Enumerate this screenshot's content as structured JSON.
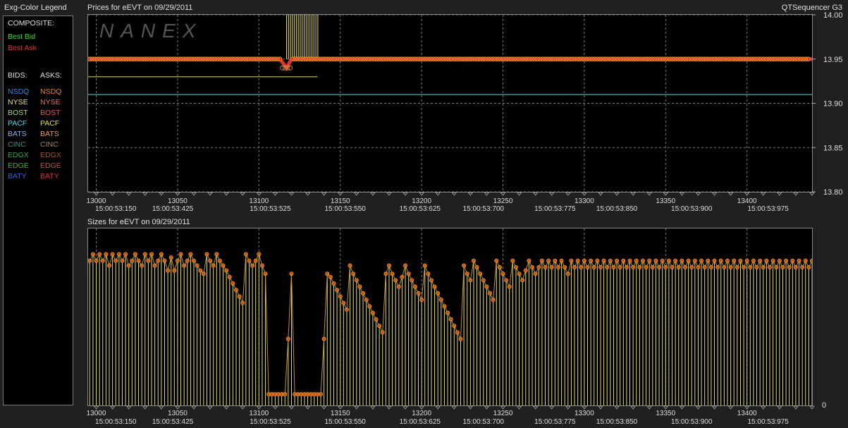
{
  "legend": {
    "title": "Exg-Color Legend",
    "composite_label": "COMPOSITE:",
    "best_bid": "Best Bid",
    "best_ask": "Best Ask",
    "bids_label": "BIDS:",
    "asks_label": "ASKS:",
    "exchanges": [
      {
        "bid": "NSDQ",
        "ask": "NSDQ",
        "bid_color": "#3a8ad8",
        "ask_color": "#e0803a"
      },
      {
        "bid": "NYSE",
        "ask": "NYSE",
        "bid_color": "#e8e060",
        "ask_color": "#e07070"
      },
      {
        "bid": "BOST",
        "ask": "BOST",
        "bid_color": "#b0d870",
        "ask_color": "#d06060"
      },
      {
        "bid": "PACF",
        "ask": "PACF",
        "bid_color": "#40e0e0",
        "ask_color": "#e0e040"
      },
      {
        "bid": "BATS",
        "ask": "BATS",
        "bid_color": "#8ab0f0",
        "ask_color": "#e0a060"
      },
      {
        "bid": "CINC",
        "ask": "CINC",
        "bid_color": "#3a9090",
        "ask_color": "#a08a50"
      },
      {
        "bid": "EDGX",
        "ask": "EDGX",
        "bid_color": "#30a050",
        "ask_color": "#a05030"
      },
      {
        "bid": "EDGE",
        "ask": "EDGE",
        "bid_color": "#40b040",
        "ask_color": "#c05040"
      },
      {
        "bid": "BATY",
        "ask": "BATY",
        "bid_color": "#3060d0",
        "ask_color": "#d03030"
      }
    ],
    "colors": {
      "best_bid": "#30e030",
      "best_ask": "#e03030"
    }
  },
  "header": {
    "prices_title": "Prices for  eEVT  on  09/29/2011",
    "sizes_title": "Sizes for  eEVT  on  09/29/2011",
    "app_name": "QTSequencer G3",
    "watermark": "NANEX"
  },
  "chart_data": [
    {
      "type": "line",
      "title": "Prices for  eEVT  on  09/29/2011",
      "xlim": [
        12995,
        13440
      ],
      "ylim": [
        13.8,
        14.0
      ],
      "yticks": [
        "14.00",
        "13.95",
        "13.90",
        "13.85",
        "13.80"
      ],
      "yvalues": [
        14.0,
        13.95,
        13.9,
        13.85,
        13.8
      ],
      "xticks": [
        "13000",
        "13050",
        "13100",
        "13150",
        "13200",
        "13250",
        "13300",
        "13350",
        "13400"
      ],
      "xtick_values": [
        13000,
        13050,
        13100,
        13150,
        13200,
        13250,
        13300,
        13350,
        13400
      ],
      "time_labels": [
        "15:00:53:150",
        "15:00:53:425",
        "15:00:53:525",
        "15:00:53:550",
        "15:00:53:625",
        "15:00:53:700",
        "15:00:53:775",
        "15:00:53:850",
        "15:00:53:900",
        "15:00:53:975"
      ],
      "time_label_x": [
        13012,
        13047,
        13107,
        13153,
        13199,
        13238,
        13282,
        13320,
        13366,
        13413
      ],
      "grid": true,
      "series": [
        {
          "values_desc": "best ask",
          "x": [
            12995,
            13113,
            13117,
            13120,
            13136,
            13440
          ],
          "y": [
            13.95,
            13.95,
            13.94,
            13.95,
            13.95,
            13.95
          ],
          "color": "#e03030"
        },
        {
          "values_desc": "yellow ask",
          "x": [
            13117,
            13137
          ],
          "y": [
            14.0,
            14.0
          ],
          "color": "#e8e060"
        },
        {
          "values_desc": "yellow bid",
          "x": [
            12995,
            13136
          ],
          "y": [
            13.93,
            13.93
          ],
          "color": "#e8e060"
        },
        {
          "values_desc": "pacf bid",
          "x": [
            12995,
            13440
          ],
          "y": [
            13.91,
            13.91
          ],
          "color": "#40e0e0"
        }
      ]
    },
    {
      "type": "bar",
      "title": "Sizes for  eEVT  on  09/29/2011",
      "xlim": [
        12995,
        13440
      ],
      "ylim": [
        0,
        100
      ],
      "yticks": [
        "0"
      ],
      "yvalues": [
        0
      ],
      "xticks": [
        "13000",
        "13050",
        "13100",
        "13150",
        "13200",
        "13250",
        "13300",
        "13350",
        "13400"
      ],
      "xtick_values": [
        13000,
        13050,
        13100,
        13150,
        13200,
        13250,
        13300,
        13350,
        13400
      ],
      "time_labels": [
        "15:00:53:150",
        "15:00:53:425",
        "15:00:53:525",
        "15:00:53:550",
        "15:00:53:625",
        "15:00:53:700",
        "15:00:53:775",
        "15:00:53:850",
        "15:00:53:900",
        "15:00:53:975"
      ],
      "time_label_x": [
        13012,
        13047,
        13107,
        13153,
        13199,
        13238,
        13282,
        13320,
        13366,
        13413
      ],
      "series": [
        {
          "name": "",
          "color": "#e8e060",
          "x_start": 12996,
          "x_step": 2,
          "values": [
            88,
            92,
            88,
            92,
            88,
            92,
            85,
            92,
            88,
            92,
            88,
            92,
            85,
            88,
            92,
            88,
            85,
            92,
            88,
            92,
            85,
            88,
            92,
            88,
            82,
            90,
            82,
            88,
            92,
            85,
            88,
            92,
            88,
            85,
            82,
            80,
            92,
            88,
            85,
            92,
            88,
            85,
            82,
            78,
            74,
            70,
            66,
            62,
            92,
            88,
            85,
            88,
            92,
            85,
            80,
            6,
            6,
            6,
            6,
            6,
            6,
            40,
            80,
            6,
            6,
            6,
            6,
            6,
            6,
            6,
            6,
            6,
            40,
            80,
            78,
            74,
            70,
            66,
            62,
            58,
            85,
            80,
            76,
            72,
            68,
            64,
            60,
            56,
            52,
            48,
            44,
            80,
            85,
            80,
            76,
            72,
            78,
            85,
            80,
            76,
            72,
            68,
            64,
            85,
            80,
            76,
            72,
            68,
            64,
            60,
            56,
            52,
            48,
            44,
            40,
            85,
            80,
            76,
            88,
            84,
            80,
            76,
            72,
            68,
            64,
            88,
            84,
            80,
            76,
            72,
            88,
            84,
            80,
            76,
            82,
            88,
            84,
            80,
            84,
            88,
            84,
            88,
            84,
            88,
            84,
            88,
            84,
            80,
            88,
            84,
            88,
            84,
            88,
            84,
            88,
            84,
            88,
            84,
            88,
            84,
            88,
            84,
            88,
            84,
            88,
            84,
            88,
            84,
            88,
            84,
            88,
            84,
            88,
            84,
            88,
            84,
            88,
            84,
            88,
            84,
            88,
            84,
            88,
            84,
            88,
            84,
            88,
            84,
            88,
            84,
            88,
            84,
            88,
            84,
            88,
            84,
            88,
            84,
            88,
            84,
            88,
            84,
            88,
            84,
            88,
            84,
            88,
            84,
            88,
            84,
            88,
            84,
            88,
            84,
            88,
            84,
            88,
            84,
            88,
            84,
            88,
            84,
            88,
            84,
            88,
            84,
            88,
            84,
            88
          ]
        }
      ]
    }
  ]
}
